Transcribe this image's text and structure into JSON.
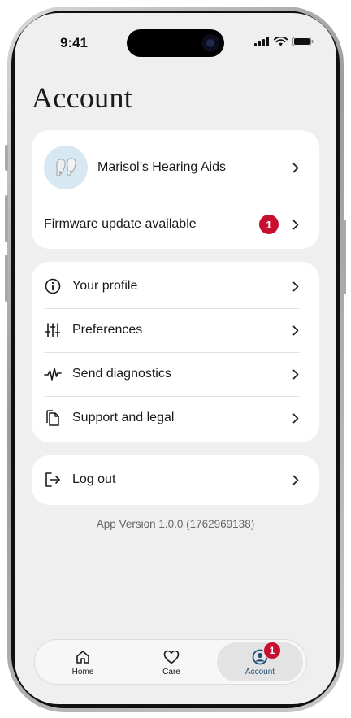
{
  "status_bar": {
    "time": "9:41"
  },
  "page": {
    "title": "Account"
  },
  "device_card": {
    "device_name": "Marisol’s Hearing Aids",
    "firmware_label": "Firmware update available",
    "firmware_badge": "1"
  },
  "menu": {
    "items": [
      {
        "label": "Your profile",
        "icon": "info-icon"
      },
      {
        "label": "Preferences",
        "icon": "sliders-icon"
      },
      {
        "label": "Send diagnostics",
        "icon": "pulse-icon"
      },
      {
        "label": "Support and legal",
        "icon": "documents-icon"
      }
    ]
  },
  "logout": {
    "label": "Log out",
    "icon": "logout-icon"
  },
  "version": {
    "text": "App Version 1.0.0 (1762969138)"
  },
  "tabbar": {
    "tabs": [
      {
        "label": "Home",
        "icon": "home-icon"
      },
      {
        "label": "Care",
        "icon": "heart-icon"
      },
      {
        "label": "Account",
        "icon": "account-icon",
        "badge": "1",
        "active": true
      }
    ]
  },
  "colors": {
    "accent": "#1f4e79",
    "badge": "#c8102e",
    "background": "#efefef",
    "card": "#ffffff"
  }
}
